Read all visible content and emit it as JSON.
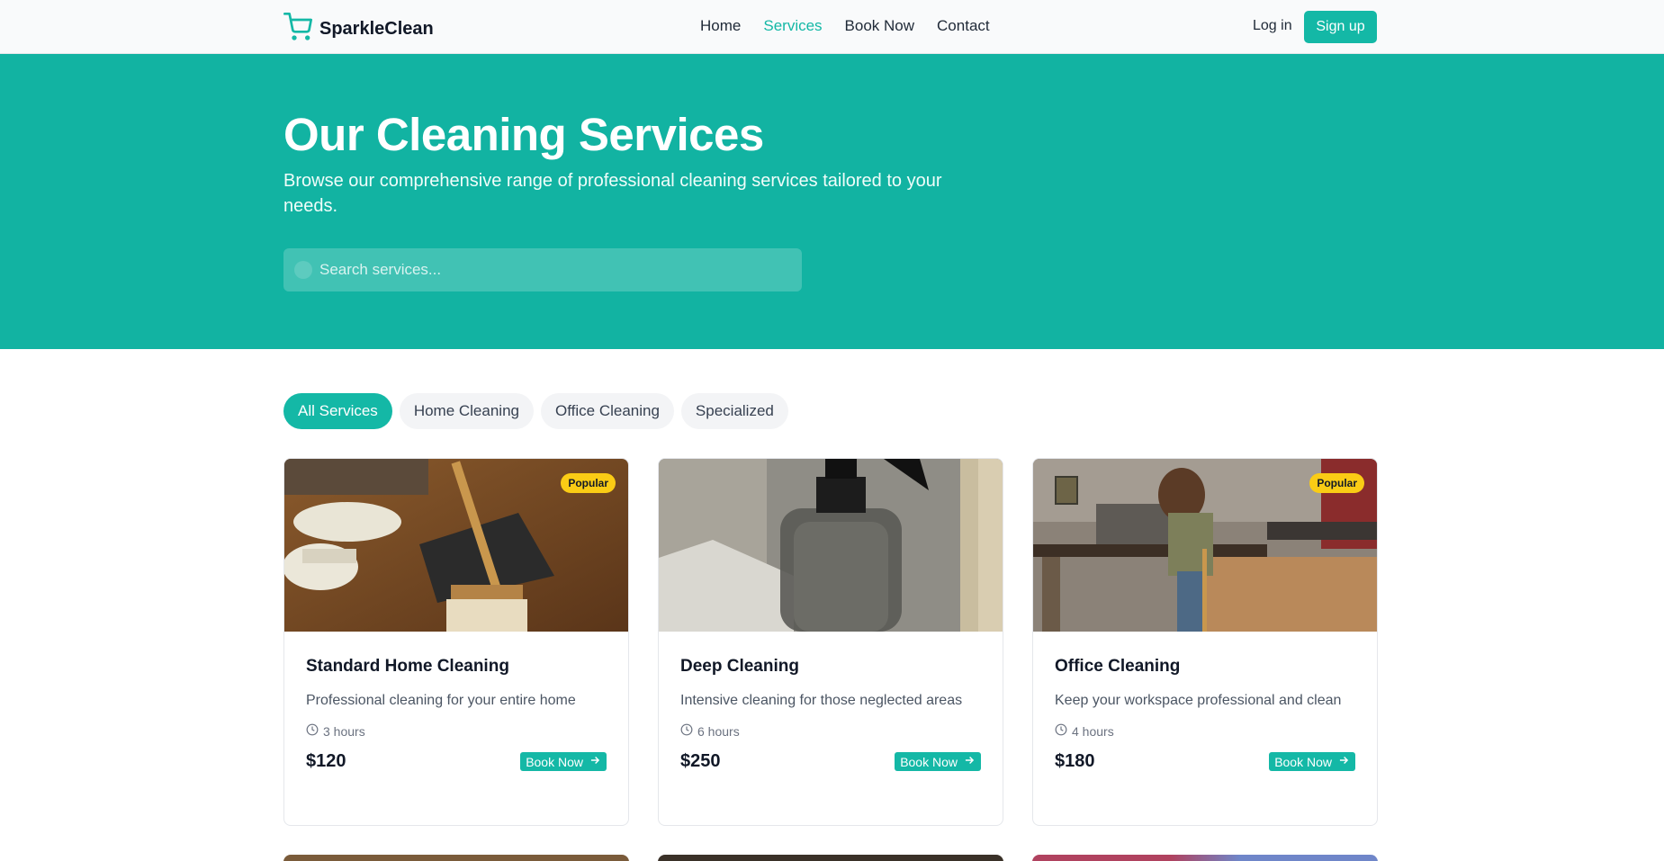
{
  "brand": {
    "name": "SparkleClean"
  },
  "nav": {
    "links": [
      "Home",
      "Services",
      "Book Now",
      "Contact"
    ],
    "active": "Services",
    "login": "Log in",
    "signup": "Sign up"
  },
  "hero": {
    "title": "Our Cleaning Services",
    "subtitle": "Browse our comprehensive range of professional cleaning services tailored to your needs.",
    "search_placeholder": "Search services..."
  },
  "filters": {
    "tabs": [
      "All Services",
      "Home Cleaning",
      "Office Cleaning",
      "Specialized"
    ],
    "active": "All Services"
  },
  "cards": [
    {
      "title": "Standard Home Cleaning",
      "description": "Professional cleaning for your entire home",
      "duration": "3 hours",
      "price": "$120",
      "badge": "Popular",
      "cta": "Book Now"
    },
    {
      "title": "Deep Cleaning",
      "description": "Intensive cleaning for those neglected areas",
      "duration": "6 hours",
      "price": "$250",
      "badge": "",
      "cta": "Book Now"
    },
    {
      "title": "Office Cleaning",
      "description": "Keep your workspace professional and clean",
      "duration": "4 hours",
      "price": "$180",
      "badge": "Popular",
      "cta": "Book Now"
    }
  ],
  "colors": {
    "accent": "#14b8a6",
    "hero_bg": "#12b3a2",
    "badge": "#facc15"
  }
}
